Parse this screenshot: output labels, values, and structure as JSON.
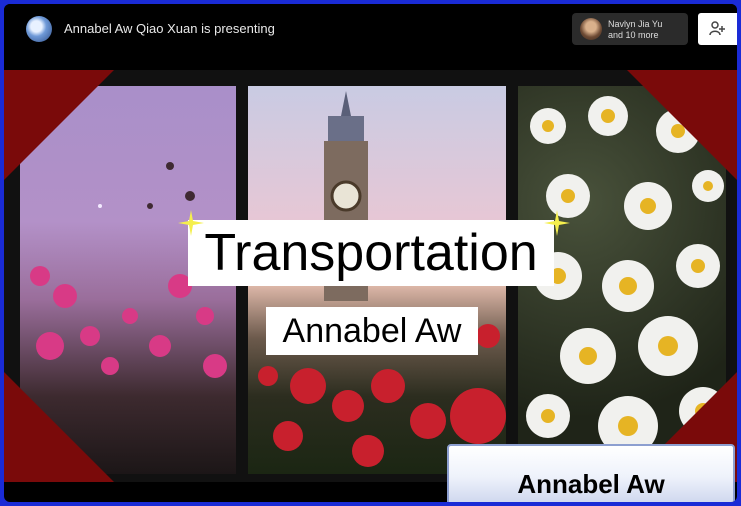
{
  "topbar": {
    "presenting_text": "Annabel Aw Qiao Xuan is presenting",
    "viewers_line1": "Navlyn Jia Yu",
    "viewers_line2": "and 10 more"
  },
  "slide": {
    "title": "Transportation",
    "subtitle": "Annabel Aw"
  },
  "name_tag": {
    "label": "Annabel Aw"
  },
  "colors": {
    "outer_border": "#1a2bd6",
    "corner_accent": "#7a0a0a",
    "star": "#f5ef4d"
  },
  "icons": [
    "presenter-avatar",
    "viewer-avatar",
    "people-icon",
    "sparkle-star-icon"
  ]
}
